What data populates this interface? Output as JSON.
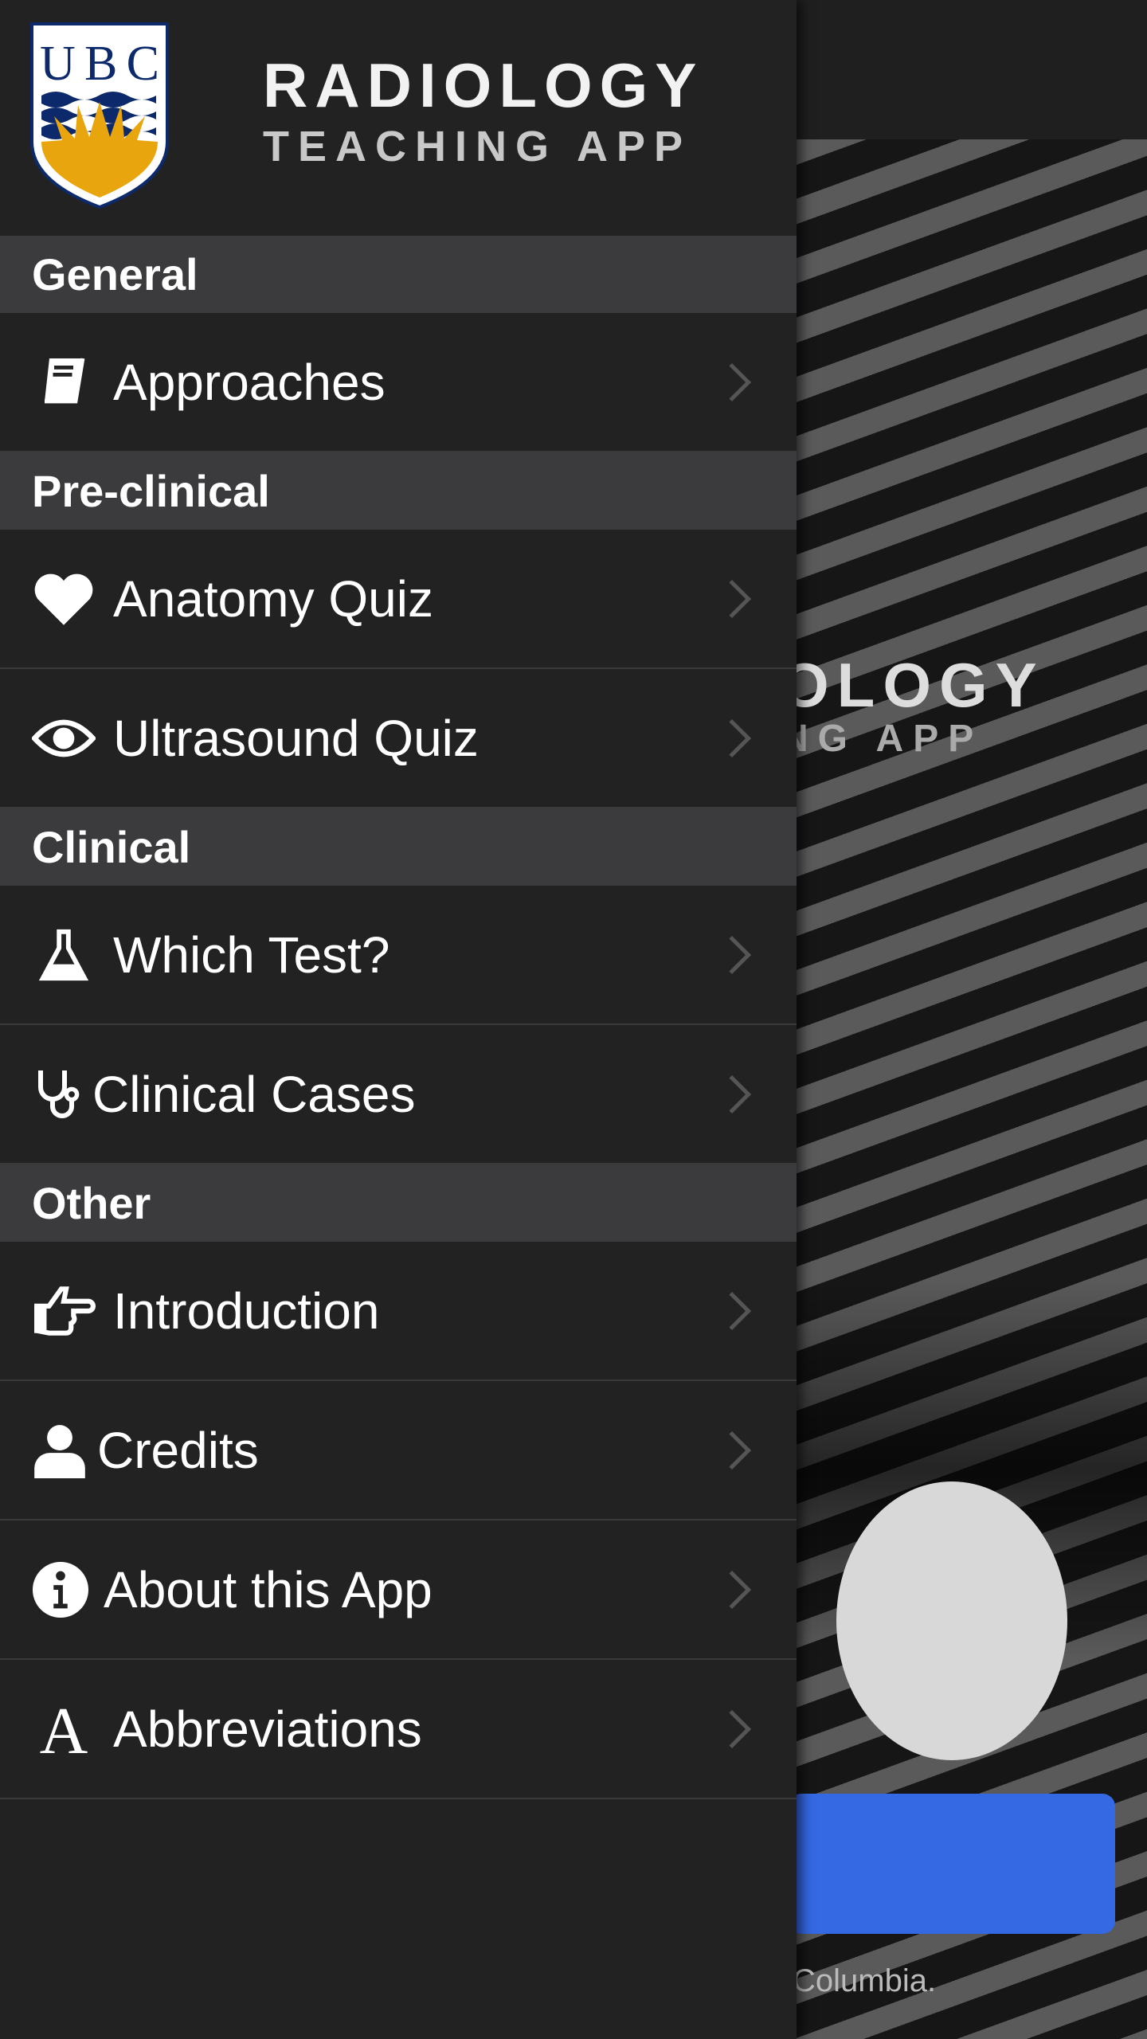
{
  "header": {
    "title": "RADIOLOGY",
    "subtitle": "TEACHING APP",
    "logo_text": "UBC"
  },
  "colors": {
    "drawer": "#222222",
    "section": "#3b3b3d",
    "accent_button": "#3569e4",
    "logo_blue": "#0c2a6b",
    "logo_gold": "#e8a50e"
  },
  "sections": [
    {
      "label": "General",
      "items": [
        {
          "label": "Approaches",
          "icon": "book-icon"
        }
      ]
    },
    {
      "label": "Pre-clinical",
      "items": [
        {
          "label": "Anatomy Quiz",
          "icon": "heart-icon"
        },
        {
          "label": "Ultrasound Quiz",
          "icon": "eye-icon"
        }
      ]
    },
    {
      "label": "Clinical",
      "items": [
        {
          "label": "Which Test?",
          "icon": "flask-icon"
        },
        {
          "label": "Clinical Cases",
          "icon": "stethoscope-icon"
        }
      ]
    },
    {
      "label": "Other",
      "items": [
        {
          "label": "Introduction",
          "icon": "hand-pointing-icon"
        },
        {
          "label": "Credits",
          "icon": "user-icon"
        },
        {
          "label": "About this App",
          "icon": "info-icon"
        },
        {
          "label": "Abbreviations",
          "icon": "font-icon"
        }
      ]
    }
  ],
  "background": {
    "title_partial": "OLOGY",
    "subtitle_partial": "NG APP",
    "footer_partial": "Columbia."
  }
}
